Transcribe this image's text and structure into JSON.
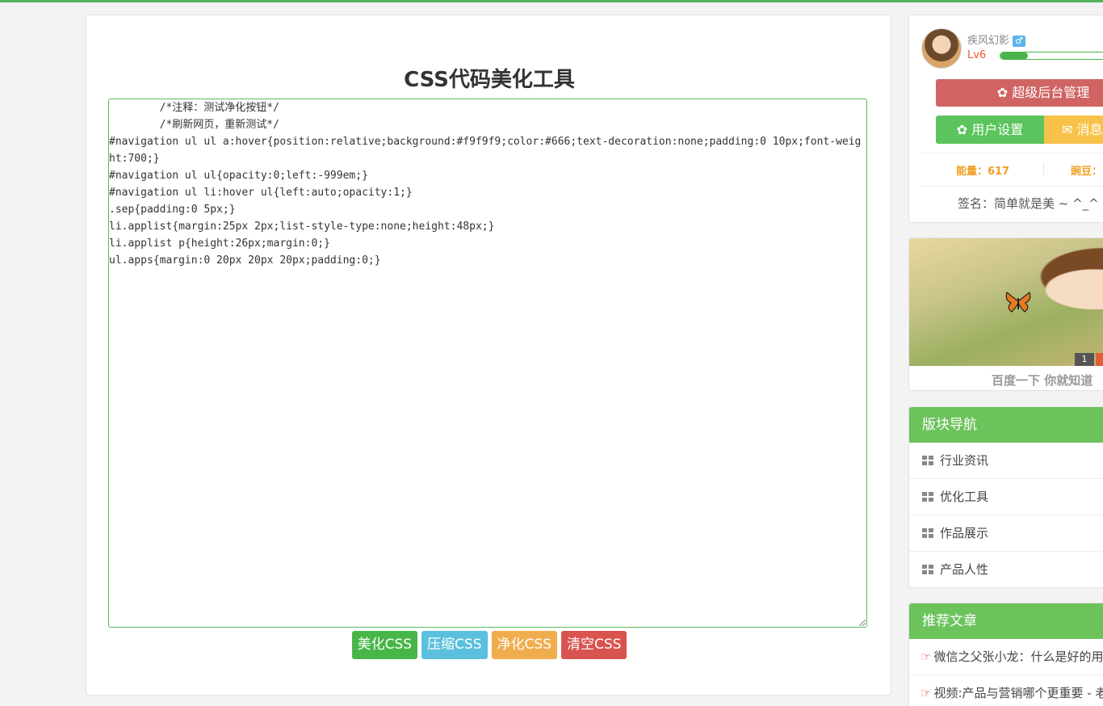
{
  "tool": {
    "title": "CSS代码美化工具",
    "code": "\t/*注释：测试净化按钮*/\n\t/*刷新网页，重新测试*/\n#navigation ul ul a:hover{position:relative;background:#f9f9f9;color:#666;text-decoration:none;padding:0 10px;font-weight:700;}\n#navigation ul ul{opacity:0;left:-999em;}\n#navigation ul li:hover ul{left:auto;opacity:1;}\n.sep{padding:0 5px;}\nli.applist{margin:25px 2px;list-style-type:none;height:48px;}\nli.applist p{height:26px;margin:0;}\nul.apps{margin:0 20px 20px 20px;padding:0;}",
    "buttons": {
      "beautify": "美化CSS",
      "compress": "压缩CSS",
      "clean": "净化CSS",
      "clear": "清空CSS"
    }
  },
  "user": {
    "name": "疾风幻影",
    "gender_icon": "male-icon",
    "gender_symbol": "♂",
    "level": "Lv6",
    "level_progress": 0.23,
    "admin_label": "超级后台管理",
    "settings_label": "用户设置",
    "messages_label": "消息",
    "energy": "能量：617",
    "beans": "豌豆：",
    "signature": "签名：简单就是美 ~ ^_^"
  },
  "banner": {
    "slide_number": "1",
    "caption": "百度一下 你就知道"
  },
  "nav": {
    "title": "版块导航",
    "items": [
      {
        "label": "行业资讯"
      },
      {
        "label": "优化工具"
      },
      {
        "label": "作品展示"
      },
      {
        "label": "产品人性"
      }
    ]
  },
  "recommended": {
    "title": "推荐文章",
    "items": [
      {
        "label": "微信之父张小龙：什么是好的用户体验"
      },
      {
        "label": "视频:产品与营销哪个更重要 - 老"
      }
    ]
  },
  "colors": {
    "accent": "#52b35f",
    "beautify": "#48b548",
    "compress": "#5bc0de",
    "clean": "#f0ad4e",
    "clear": "#d9534f",
    "admin": "#d06463",
    "header": "#6cc35c"
  }
}
